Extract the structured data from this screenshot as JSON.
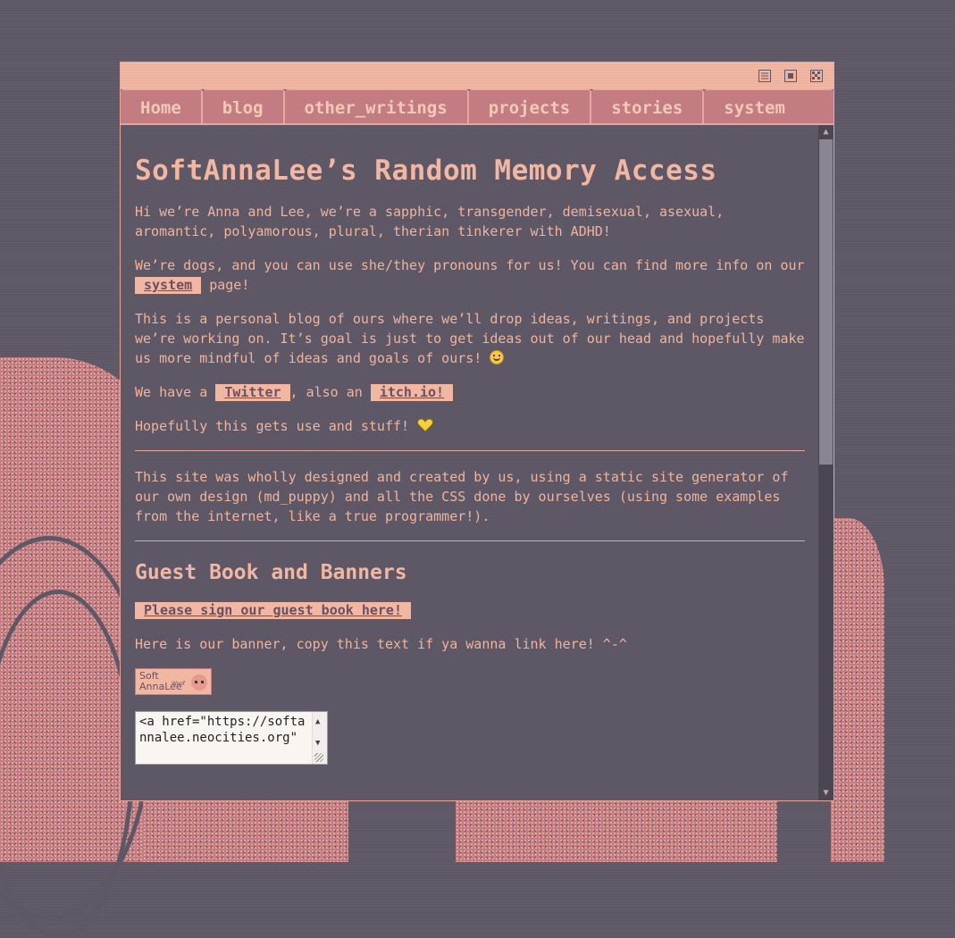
{
  "window": {
    "controls": [
      "minimize-icon",
      "maximize-icon",
      "close-icon"
    ]
  },
  "nav": {
    "tabs": [
      "Home",
      "blog",
      "other_writings",
      "projects",
      "stories",
      "system"
    ]
  },
  "main": {
    "title": "SoftAnnaLee’s Random Memory Access",
    "intro": "Hi we’re Anna and Lee, we’re a sapphic, transgender, demisexual, asexual, aromantic, polyamorous, plural, therian tinkerer with ADHD!",
    "dogs_text_before": "We’re dogs, and you can use she/they pronouns for us! You can find more info on our",
    "system_link": "system",
    "dogs_text_after": "page!",
    "blog_text": "This is a personal blog of ours where we’ll drop ideas, writings, and projects we’re working on. It’s goal is just to get ideas out of our head and hopefully make us more mindful of ideas and goals of ours!",
    "smile_emoji": "smiling-face-icon",
    "have_text": "We have a",
    "twitter_link": "Twitter",
    "also_text": ", also an",
    "itch_link": "itch.io!",
    "hope_text": "Hopefully this gets use and stuff!",
    "heart_emoji": "yellow-heart-icon",
    "design_text": "This site was wholly designed and created by us, using a static site generator of our own design (md_puppy) and all the CSS done by ourselves (using some examples from the internet, like a true programmer!)."
  },
  "guestbook": {
    "heading": "Guest Book and Banners",
    "sign_link": "Please sign our guest book here!",
    "banner_text": "Here is our banner, copy this text if ya wanna link here! ^-^",
    "banner_line1": "Soft",
    "banner_line2": "AnnaLee",
    "banner_woof": "Woof",
    "code_value": "<a href=\"https://softannalee.neocities.org\""
  },
  "colors": {
    "background": "#5d5766",
    "accent": "#f2b7a3",
    "tab": "#c27c82",
    "text": "#f0b49c"
  }
}
